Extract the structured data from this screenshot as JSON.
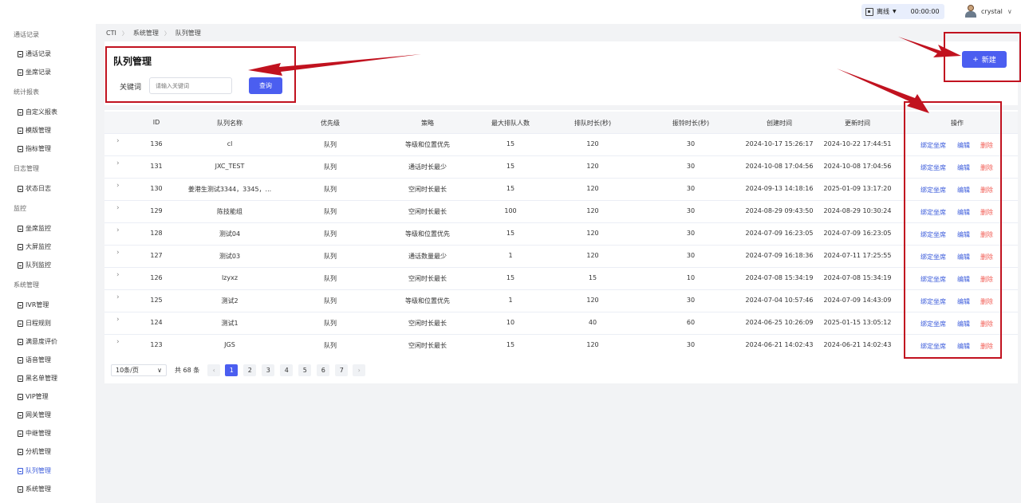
{
  "header": {
    "status": "离线",
    "timer": "00:00:00",
    "username": "crystal"
  },
  "sidebar": {
    "items": [
      {
        "type": "group",
        "label": "通话记录"
      },
      {
        "type": "item",
        "label": "通话记录"
      },
      {
        "type": "item",
        "label": "坐席记录"
      },
      {
        "type": "group",
        "label": "统计报表"
      },
      {
        "type": "item",
        "label": "自定义报表"
      },
      {
        "type": "item",
        "label": "模版管理"
      },
      {
        "type": "item",
        "label": "指标管理"
      },
      {
        "type": "group",
        "label": "日志管理"
      },
      {
        "type": "item",
        "label": "状态日志"
      },
      {
        "type": "group",
        "label": "监控"
      },
      {
        "type": "item",
        "label": "坐席监控"
      },
      {
        "type": "item",
        "label": "大屏监控"
      },
      {
        "type": "item",
        "label": "队列监控"
      },
      {
        "type": "group",
        "label": "系统管理"
      },
      {
        "type": "item",
        "label": "IVR管理"
      },
      {
        "type": "item",
        "label": "日程规则"
      },
      {
        "type": "item",
        "label": "满意度评价"
      },
      {
        "type": "item",
        "label": "语音管理"
      },
      {
        "type": "item",
        "label": "黑名单管理"
      },
      {
        "type": "item",
        "label": "VIP管理"
      },
      {
        "type": "item",
        "label": "网关管理"
      },
      {
        "type": "item",
        "label": "中继管理"
      },
      {
        "type": "item",
        "label": "分机管理"
      },
      {
        "type": "item",
        "label": "队列管理",
        "active": true
      },
      {
        "type": "item",
        "label": "系统管理"
      }
    ]
  },
  "breadcrumb": [
    "CTI",
    "系统管理",
    "队列管理"
  ],
  "page": {
    "title": "队列管理",
    "keyword_label": "关键词",
    "keyword_placeholder": "请输入关键词",
    "query_label": "查询",
    "new_label": "新建"
  },
  "table": {
    "columns": [
      "ID",
      "队列名称",
      "优先级",
      "策略",
      "最大排队人数",
      "排队时长(秒)",
      "振铃时长(秒)",
      "创建时间",
      "更新时间",
      "操作"
    ],
    "rows": [
      [
        "136",
        "cl",
        "队列",
        "等级和位置优先",
        "15",
        "120",
        "30",
        "2024-10-17 15:26:17",
        "2024-10-22 17:44:51"
      ],
      [
        "131",
        "JXC_TEST",
        "队列",
        "通话时长最少",
        "15",
        "120",
        "30",
        "2024-10-08 17:04:56",
        "2024-10-08 17:04:56"
      ],
      [
        "130",
        "姜港生测试3344，3345，...",
        "队列",
        "空闲时长最长",
        "15",
        "120",
        "30",
        "2024-09-13 14:18:16",
        "2025-01-09 13:17:20"
      ],
      [
        "129",
        "陈技能组",
        "队列",
        "空闲时长最长",
        "100",
        "120",
        "30",
        "2024-08-29 09:43:50",
        "2024-08-29 10:30:24"
      ],
      [
        "128",
        "测试04",
        "队列",
        "等级和位置优先",
        "15",
        "120",
        "30",
        "2024-07-09 16:23:05",
        "2024-07-09 16:23:05"
      ],
      [
        "127",
        "测试03",
        "队列",
        "通话数量最少",
        "1",
        "120",
        "30",
        "2024-07-09 16:18:36",
        "2024-07-11 17:25:55"
      ],
      [
        "126",
        "lzyxz",
        "队列",
        "空闲时长最长",
        "15",
        "15",
        "10",
        "2024-07-08 15:34:19",
        "2024-07-08 15:34:19"
      ],
      [
        "125",
        "测试2",
        "队列",
        "等级和位置优先",
        "1",
        "120",
        "30",
        "2024-07-04 10:57:46",
        "2024-07-09 14:43:09"
      ],
      [
        "124",
        "测试1",
        "队列",
        "空闲时长最长",
        "10",
        "40",
        "60",
        "2024-06-25 10:26:09",
        "2025-01-15 13:05:12"
      ],
      [
        "123",
        "JGS",
        "队列",
        "空闲时长最长",
        "15",
        "120",
        "30",
        "2024-06-21 14:02:43",
        "2024-06-21 14:02:43"
      ]
    ],
    "actions": [
      "绑定坐席",
      "编辑",
      "删除"
    ]
  },
  "pagination": {
    "page_size": "10条/页",
    "total": "共 68 条",
    "pages": [
      "1",
      "2",
      "3",
      "4",
      "5",
      "6",
      "7"
    ],
    "current": "1"
  },
  "colors": {
    "primary": "#4b5ef0",
    "link": "#3b5bdb",
    "danger": "#f25c54",
    "annotation": "#c1121f"
  }
}
